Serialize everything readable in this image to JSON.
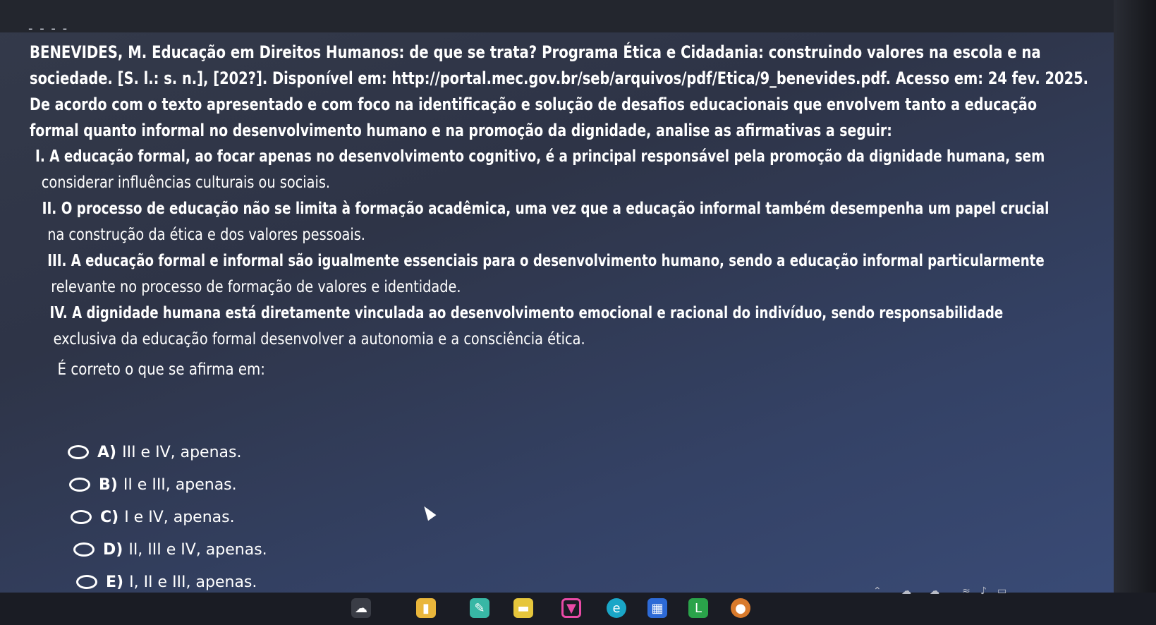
{
  "document": {
    "reference_line_1": "BENEVIDES, M. Educação em Direitos Humanos: de que se trata? Programa Ética e Cidadania: construindo valores na escola e na",
    "reference_line_2": "sociedade. [S. l.: s. n.], [202?]. Disponível em: http://portal.mec.gov.br/seb/arquivos/pdf/Etica/9_benevides.pdf. Acesso em: 24 fev. 2025.",
    "prompt_line_1": "De acordo com o texto apresentado e com foco na identificação e solução de desafios educacionais que envolvem tanto a educação",
    "prompt_line_2": "formal quanto informal no desenvolvimento humano e na promoção da dignidade, analise as afirmativas a seguir:",
    "statements": [
      {
        "line_1": "I. A educação formal, ao focar apenas no desenvolvimento cognitivo, é a principal responsável pela promoção da dignidade humana, sem",
        "line_2": "considerar influências culturais ou sociais."
      },
      {
        "line_1": "II. O processo de educação não se limita à formação acadêmica, uma vez que a educação informal também desempenha um papel crucial",
        "line_2": "na construção da ética e dos valores pessoais."
      },
      {
        "line_1": "III. A educação formal e informal são igualmente essenciais para o desenvolvimento humano, sendo a educação informal particularmente",
        "line_2": "relevante no processo de formação de valores e identidade."
      },
      {
        "line_1": "IV. A dignidade humana está diretamente vinculada ao desenvolvimento emocional e racional do indivíduo, sendo responsabilidade",
        "line_2": "exclusiva da educação formal desenvolver a autonomia e a consciência ética."
      }
    ],
    "question": "É correto o que se afirma em:"
  },
  "options": [
    {
      "letter": "A)",
      "text": "III e IV, apenas."
    },
    {
      "letter": "B)",
      "text": "II e III, apenas."
    },
    {
      "letter": "C)",
      "text": "I e IV, apenas."
    },
    {
      "letter": "D)",
      "text": "II, III e IV, apenas."
    },
    {
      "letter": "E)",
      "text": "I, II e III, apenas."
    }
  ],
  "colors": {
    "background": "#343a4a",
    "text": "#ffffff",
    "taskbar": "#1a1c24"
  },
  "taskbar": {
    "icons": [
      "widgets-icon",
      "file-explorer-icon",
      "paint-icon",
      "notes-icon",
      "shield-icon",
      "edge-icon",
      "store-icon",
      "app-icon",
      "ai-chat-icon"
    ],
    "tray_icons": [
      "chevron-up-icon",
      "cloud-icon",
      "onedrive-icon",
      "wifi-icon",
      "volume-icon",
      "battery-icon"
    ]
  }
}
